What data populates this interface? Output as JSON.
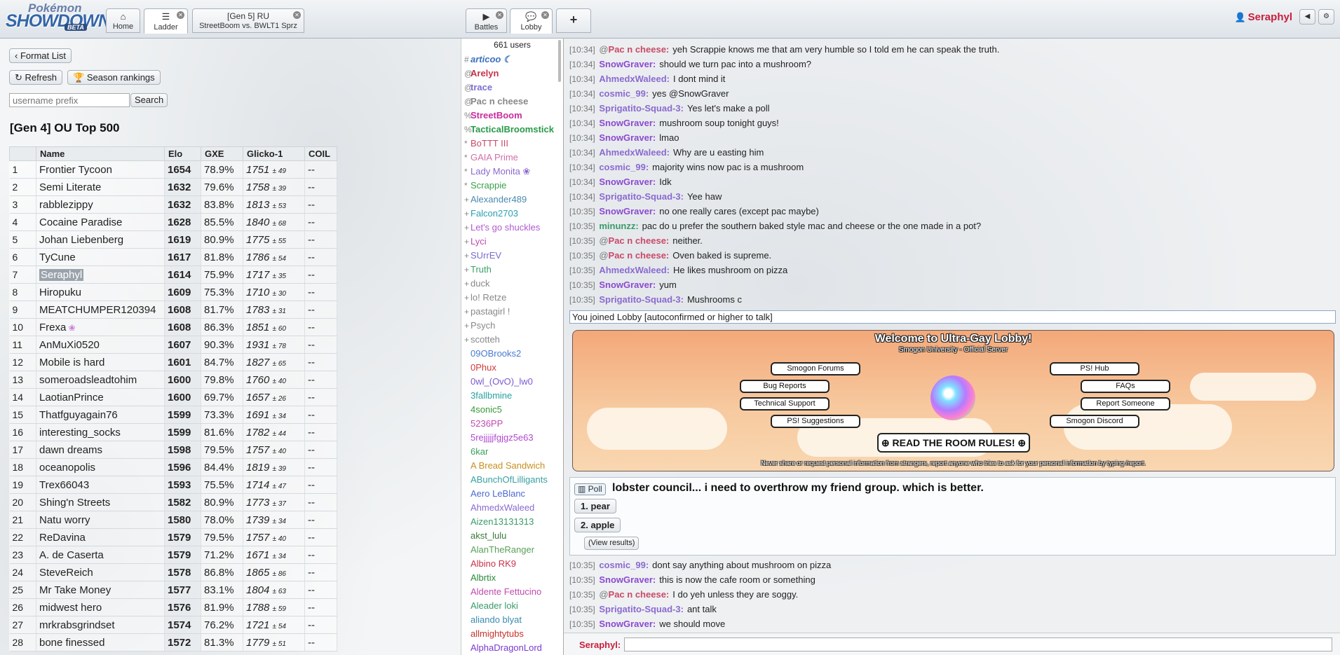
{
  "header": {
    "logo": {
      "line1": "Pokémon",
      "line2": "SHOWDOWN!",
      "badge": "BETA"
    },
    "tabs": [
      {
        "label": "Home",
        "icon": "home-icon"
      },
      {
        "label": "Ladder",
        "icon": "list-icon"
      },
      {
        "label_top": "[Gen 5] RU",
        "label": "StreetBoom vs. BWLT1 Sprz"
      },
      {
        "label": "Battles",
        "icon": "battles-icon"
      },
      {
        "label": "Lobby",
        "icon": "chat-icon"
      },
      {
        "label": "+"
      }
    ],
    "user": "Seraphyl",
    "colors": {
      "user": "#c81e3c"
    }
  },
  "ladder": {
    "format_list": "Format List",
    "refresh": "Refresh",
    "season": "Season rankings",
    "search_placeholder": "username prefix",
    "search_button": "Search",
    "title": "[Gen 4] OU Top 500",
    "columns": [
      "",
      "Name",
      "Elo",
      "GXE",
      "Glicko-1",
      "COIL"
    ],
    "rows": [
      {
        "rank": "1",
        "name": "Frontier Tycoon",
        "elo": "1654",
        "gxe": "78.9%",
        "glicko": "1751",
        "dev": "± 49",
        "coil": "--"
      },
      {
        "rank": "2",
        "name": "Semi Literate",
        "elo": "1632",
        "gxe": "79.6%",
        "glicko": "1758",
        "dev": "± 39",
        "coil": "--"
      },
      {
        "rank": "3",
        "name": "rabblezippy",
        "elo": "1632",
        "gxe": "83.8%",
        "glicko": "1813",
        "dev": "± 53",
        "coil": "--"
      },
      {
        "rank": "4",
        "name": "Cocaine Paradise",
        "elo": "1628",
        "gxe": "85.5%",
        "glicko": "1840",
        "dev": "± 68",
        "coil": "--"
      },
      {
        "rank": "5",
        "name": "Johan Liebenberg",
        "elo": "1619",
        "gxe": "80.9%",
        "glicko": "1775",
        "dev": "± 55",
        "coil": "--"
      },
      {
        "rank": "6",
        "name": "TyCune",
        "elo": "1617",
        "gxe": "81.8%",
        "glicko": "1786",
        "dev": "± 54",
        "coil": "--"
      },
      {
        "rank": "7",
        "name": "Seraphyl",
        "elo": "1614",
        "gxe": "75.9%",
        "glicko": "1717",
        "dev": "± 35",
        "coil": "--"
      },
      {
        "rank": "8",
        "name": "Hiropuku",
        "elo": "1609",
        "gxe": "75.3%",
        "glicko": "1710",
        "dev": "± 30",
        "coil": "--"
      },
      {
        "rank": "9",
        "name": "MEATCHUMPER120394",
        "elo": "1608",
        "gxe": "81.7%",
        "glicko": "1783",
        "dev": "± 31",
        "coil": "--"
      },
      {
        "rank": "10",
        "name": "Frexa",
        "elo": "1608",
        "gxe": "86.3%",
        "glicko": "1851",
        "dev": "± 60",
        "coil": "--"
      },
      {
        "rank": "11",
        "name": "AnMuXi0520",
        "elo": "1607",
        "gxe": "90.3%",
        "glicko": "1931",
        "dev": "± 78",
        "coil": "--"
      },
      {
        "rank": "12",
        "name": "Mobile is hard",
        "elo": "1601",
        "gxe": "84.7%",
        "glicko": "1827",
        "dev": "± 65",
        "coil": "--"
      },
      {
        "rank": "13",
        "name": "someroadsleadtohim",
        "elo": "1600",
        "gxe": "79.8%",
        "glicko": "1760",
        "dev": "± 40",
        "coil": "--"
      },
      {
        "rank": "14",
        "name": "LaotianPrince",
        "elo": "1600",
        "gxe": "69.7%",
        "glicko": "1657",
        "dev": "± 26",
        "coil": "--"
      },
      {
        "rank": "15",
        "name": "Thatfguyagain76",
        "elo": "1599",
        "gxe": "73.3%",
        "glicko": "1691",
        "dev": "± 34",
        "coil": "--"
      },
      {
        "rank": "16",
        "name": "interesting_socks",
        "elo": "1599",
        "gxe": "81.6%",
        "glicko": "1782",
        "dev": "± 44",
        "coil": "--"
      },
      {
        "rank": "17",
        "name": "dawn dreams",
        "elo": "1598",
        "gxe": "79.5%",
        "glicko": "1757",
        "dev": "± 40",
        "coil": "--"
      },
      {
        "rank": "18",
        "name": "oceanopolis",
        "elo": "1596",
        "gxe": "84.4%",
        "glicko": "1819",
        "dev": "± 39",
        "coil": "--"
      },
      {
        "rank": "19",
        "name": "Trex66043",
        "elo": "1593",
        "gxe": "75.5%",
        "glicko": "1714",
        "dev": "± 47",
        "coil": "--"
      },
      {
        "rank": "20",
        "name": "Shing'n Streets",
        "elo": "1582",
        "gxe": "80.9%",
        "glicko": "1773",
        "dev": "± 37",
        "coil": "--"
      },
      {
        "rank": "21",
        "name": "Natu worry",
        "elo": "1580",
        "gxe": "78.0%",
        "glicko": "1739",
        "dev": "± 34",
        "coil": "--"
      },
      {
        "rank": "22",
        "name": "ReDavina",
        "elo": "1579",
        "gxe": "79.5%",
        "glicko": "1757",
        "dev": "± 40",
        "coil": "--"
      },
      {
        "rank": "23",
        "name": "A. de Caserta",
        "elo": "1579",
        "gxe": "71.2%",
        "glicko": "1671",
        "dev": "± 34",
        "coil": "--"
      },
      {
        "rank": "24",
        "name": "SteveReich",
        "elo": "1578",
        "gxe": "86.8%",
        "glicko": "1865",
        "dev": "± 86",
        "coil": "--"
      },
      {
        "rank": "25",
        "name": "Mr Take Money",
        "elo": "1577",
        "gxe": "83.1%",
        "glicko": "1804",
        "dev": "± 63",
        "coil": "--"
      },
      {
        "rank": "26",
        "name": "midwest hero",
        "elo": "1576",
        "gxe": "81.9%",
        "glicko": "1788",
        "dev": "± 59",
        "coil": "--"
      },
      {
        "rank": "27",
        "name": "mrkrabsgrindset",
        "elo": "1574",
        "gxe": "76.2%",
        "glicko": "1721",
        "dev": "± 54",
        "coil": "--"
      },
      {
        "rank": "28",
        "name": "bone finessed",
        "elo": "1572",
        "gxe": "81.3%",
        "glicko": "1779",
        "dev": "± 51",
        "coil": "--"
      }
    ]
  },
  "userlist": {
    "count": "661 users",
    "users": [
      {
        "group": "#",
        "name": "articoo ☾",
        "color": "#3b6fc2",
        "bold": true,
        "italic": true
      },
      {
        "group": "@",
        "name": "Arelyn",
        "color": "#c8324a",
        "bold": true
      },
      {
        "group": "@",
        "name": "trace",
        "color": "#7a6fd0",
        "bold": true
      },
      {
        "group": "@",
        "name": "Pac n cheese",
        "color": "#888888",
        "bold": true
      },
      {
        "group": "%",
        "name": "StreetBoom",
        "color": "#c82d9f",
        "bold": true
      },
      {
        "group": "%",
        "name": "TacticalBroomstick",
        "color": "#2a9a4a",
        "bold": true
      },
      {
        "group": "*",
        "name": "BoTTT III",
        "color": "#c84a68"
      },
      {
        "group": "*",
        "name": "GAIA Prime",
        "color": "#d070a8"
      },
      {
        "group": "*",
        "name": "Lady Monita ❀",
        "color": "#8a6ad0"
      },
      {
        "group": "*",
        "name": "Scrappie",
        "color": "#3aa04a"
      },
      {
        "group": "+",
        "name": "Alexander489",
        "color": "#4a8ab0"
      },
      {
        "group": "+",
        "name": "Falcon2703",
        "color": "#2aa0b0"
      },
      {
        "group": "+",
        "name": "Let's go shuckles",
        "color": "#b05ad0"
      },
      {
        "group": "+",
        "name": "Lyci",
        "color": "#c04ab0"
      },
      {
        "group": "+",
        "name": "SUrrEV",
        "color": "#7a6ad0"
      },
      {
        "group": "+",
        "name": "Truth",
        "color": "#3aa06a"
      },
      {
        "group": "+",
        "name": "duck",
        "color": "#888888"
      },
      {
        "group": "+",
        "name": "lo! Retze",
        "color": "#888888"
      },
      {
        "group": "+",
        "name": "pastagirl !",
        "color": "#888888"
      },
      {
        "group": "+",
        "name": "Psych",
        "color": "#888888"
      },
      {
        "group": "+",
        "name": "scotteh",
        "color": "#888888"
      },
      {
        "group": "",
        "name": "09OBrooks2",
        "color": "#4a7ad0"
      },
      {
        "group": "",
        "name": "0Phux",
        "color": "#d03a3a"
      },
      {
        "group": "",
        "name": "0wl_(OvO)_lw0",
        "color": "#7a5ad0"
      },
      {
        "group": "",
        "name": "3fallbmine",
        "color": "#2aa0a0"
      },
      {
        "group": "",
        "name": "4sonic5",
        "color": "#3a9a3a"
      },
      {
        "group": "",
        "name": "5236PP",
        "color": "#c04ab0"
      },
      {
        "group": "",
        "name": "5rejjjjjfgjgz5e63",
        "color": "#b04ad0"
      },
      {
        "group": "",
        "name": "6kar",
        "color": "#3aa05a"
      },
      {
        "group": "",
        "name": "A Bread Sandwich",
        "color": "#c89020"
      },
      {
        "group": "",
        "name": "ABunchOfLilligants",
        "color": "#3aa0a0"
      },
      {
        "group": "",
        "name": "Aero LeBlanc",
        "color": "#4a6ad0"
      },
      {
        "group": "",
        "name": "AhmedxWaleed",
        "color": "#8a6ad0"
      },
      {
        "group": "",
        "name": "Aizen13131313",
        "color": "#3a9a6a"
      },
      {
        "group": "",
        "name": "akst_lulu",
        "color": "#3a7a3a"
      },
      {
        "group": "",
        "name": "AlanTheRanger",
        "color": "#5aa05a"
      },
      {
        "group": "",
        "name": "Albino RK9",
        "color": "#c8324a"
      },
      {
        "group": "",
        "name": "Albrtix",
        "color": "#2a8a3a"
      },
      {
        "group": "",
        "name": "Aldente Fettucino",
        "color": "#c04ab0"
      },
      {
        "group": "",
        "name": "Aleader loki",
        "color": "#3a9a6a"
      },
      {
        "group": "",
        "name": "aliando blyat",
        "color": "#3a8ab0"
      },
      {
        "group": "",
        "name": "allmightytubs",
        "color": "#c8322a"
      },
      {
        "group": "",
        "name": "AlphaDragonLord",
        "color": "#7a3ad0"
      }
    ]
  },
  "chat": {
    "messages_top": [
      {
        "time": "[10:34]",
        "rank": "@",
        "author": "Pac n cheese:",
        "color": "#c84a68",
        "text": "yeh Scrappie knows me that am very humble so I told em he can speak the truth."
      },
      {
        "time": "[10:34]",
        "rank": "",
        "author": "SnowGraver:",
        "color": "#8a4ad0",
        "text": "should we turn pac into a mushroom?"
      },
      {
        "time": "[10:34]",
        "rank": "",
        "author": "AhmedxWaleed:",
        "color": "#8a6ad0",
        "text": "I dont mind it"
      },
      {
        "time": "[10:34]",
        "rank": "",
        "author": "cosmic_99:",
        "color": "#8a6ad0",
        "text": "yes @SnowGraver"
      },
      {
        "time": "[10:34]",
        "rank": "",
        "author": "Sprigatito-Squad-3:",
        "color": "#8a6ad0",
        "text": "Yes let's make a poll"
      },
      {
        "time": "[10:34]",
        "rank": "",
        "author": "SnowGraver:",
        "color": "#8a4ad0",
        "text": "mushroom soup tonight guys!"
      },
      {
        "time": "[10:34]",
        "rank": "",
        "author": "SnowGraver:",
        "color": "#8a4ad0",
        "text": "lmao"
      },
      {
        "time": "[10:34]",
        "rank": "",
        "author": "AhmedxWaleed:",
        "color": "#8a6ad0",
        "text": "Why are u easting him"
      },
      {
        "time": "[10:34]",
        "rank": "",
        "author": "cosmic_99:",
        "color": "#8a6ad0",
        "text": "majority wins now pac is a mushroom"
      },
      {
        "time": "[10:34]",
        "rank": "",
        "author": "SnowGraver:",
        "color": "#8a4ad0",
        "text": "Idk"
      },
      {
        "time": "[10:34]",
        "rank": "",
        "author": "Sprigatito-Squad-3:",
        "color": "#8a6ad0",
        "text": "Yee haw"
      },
      {
        "time": "[10:35]",
        "rank": "",
        "author": "SnowGraver:",
        "color": "#8a4ad0",
        "text": "no one really cares (except pac maybe)"
      },
      {
        "time": "[10:35]",
        "rank": "",
        "author": "minunzz:",
        "color": "#3a9a6a",
        "text": "pac do u prefer the southern baked style mac and cheese or the one made in a pot?"
      },
      {
        "time": "[10:35]",
        "rank": "@",
        "author": "Pac n cheese:",
        "color": "#c84a68",
        "text": "neither."
      },
      {
        "time": "[10:35]",
        "rank": "@",
        "author": "Pac n cheese:",
        "color": "#c84a68",
        "text": "Oven baked is supreme."
      },
      {
        "time": "[10:35]",
        "rank": "",
        "author": "AhmedxWaleed:",
        "color": "#8a6ad0",
        "text": "He likes mushroom on pizza"
      },
      {
        "time": "[10:35]",
        "rank": "",
        "author": "SnowGraver:",
        "color": "#8a4ad0",
        "text": "yum"
      },
      {
        "time": "[10:35]",
        "rank": "",
        "author": "Sprigatito-Squad-3:",
        "color": "#8a6ad0",
        "text": "Mushrooms c"
      }
    ],
    "notice": "You joined Lobby [autoconfirmed or higher to talk]",
    "banner": {
      "title": "Welcome to Ultra-Gay Lobby!",
      "subtitle": "Smogon University - Official Server",
      "buttons": [
        "Smogon Forums",
        "Bug Reports",
        "Technical Support",
        "PS! Suggestions",
        "PS! Hub",
        "FAQs",
        "Report Someone",
        "Smogon Discord"
      ],
      "rules": "⊕ READ THE ROOM RULES! ⊕",
      "footer": "Never share or request personal information from strangers, report anyone who tries to ask for your personal information by typing /report."
    },
    "poll": {
      "badge": "Poll",
      "question": "lobster council... i need to overthrow my friend group. which is better.",
      "options": [
        "1. pear",
        "2. apple"
      ],
      "view_results": "(View results)"
    },
    "messages_bottom": [
      {
        "time": "[10:35]",
        "rank": "",
        "author": "cosmic_99:",
        "color": "#8a6ad0",
        "text": "dont say anything about mushroom on pizza"
      },
      {
        "time": "[10:35]",
        "rank": "",
        "author": "SnowGraver:",
        "color": "#8a4ad0",
        "text": "this is now the cafe room or something"
      },
      {
        "time": "[10:35]",
        "rank": "@",
        "author": "Pac n cheese:",
        "color": "#c84a68",
        "text": "I do yeh unless they are soggy."
      },
      {
        "time": "[10:35]",
        "rank": "",
        "author": "Sprigatito-Squad-3:",
        "color": "#8a6ad0",
        "text": "ant talk"
      },
      {
        "time": "[10:35]",
        "rank": "",
        "author": "SnowGraver:",
        "color": "#8a4ad0",
        "text": "we should move"
      }
    ],
    "input_label": "Seraphyl:"
  }
}
